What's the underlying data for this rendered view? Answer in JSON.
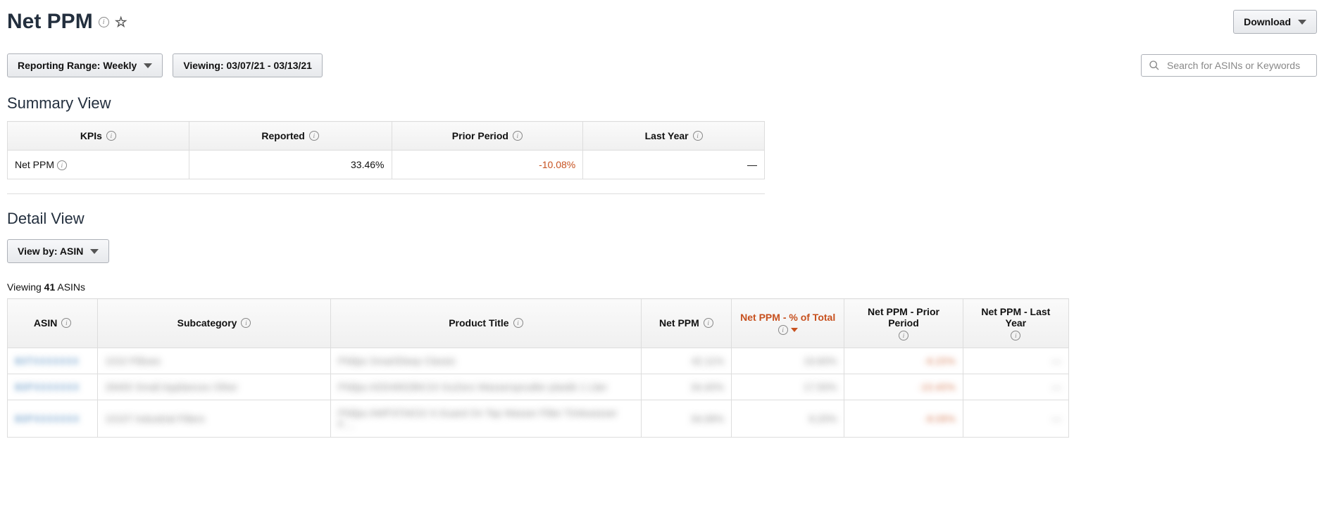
{
  "header": {
    "title": "Net PPM",
    "download_label": "Download"
  },
  "filters": {
    "reporting_range_label": "Reporting Range: Weekly",
    "viewing_label": "Viewing: 03/07/21 - 03/13/21",
    "search_placeholder": "Search for ASINs or Keywords"
  },
  "summary": {
    "section_title": "Summary View",
    "columns": {
      "kpis": "KPIs",
      "reported": "Reported",
      "prior_period": "Prior Period",
      "last_year": "Last Year"
    },
    "row": {
      "label": "Net PPM",
      "reported": "33.46%",
      "prior_period": "-10.08%",
      "last_year": "—"
    }
  },
  "detail": {
    "section_title": "Detail View",
    "view_by_label": "View by: ASIN",
    "viewing_count_prefix": "Viewing ",
    "viewing_count": "41",
    "viewing_count_suffix": " ASINs",
    "columns": {
      "asin": "ASIN",
      "subcategory": "Subcategory",
      "product_title": "Product Title",
      "net_ppm": "Net PPM",
      "pct_of_total": "Net PPM - % of Total",
      "prior_period": "Net PPM - Prior Period",
      "last_year": "Net PPM - Last Year"
    },
    "rows": [
      {
        "asin": "B0TXXXXXXX",
        "subcategory": "1010 Pillows",
        "title": "Philips SmartSleep Classic",
        "net_ppm": "42.11%",
        "pct_of_total": "19.60%",
        "prior_period": "-6.20%",
        "last_year": "—"
      },
      {
        "asin": "B0PXXXXXXX",
        "subcategory": "26400 Small Appliances Other",
        "title": "Philips ADD4902BK/10 GoZero Wassersprudler plastik 1 Liter",
        "net_ppm": "34.40%",
        "pct_of_total": "17.50%",
        "prior_period": "-10.40%",
        "last_year": "—"
      },
      {
        "asin": "B0PXXXXXXX",
        "subcategory": "10107 Industrial Filters",
        "title": "Philips AWP3704/10 X-Guard On Tap Wasser Filter Trinkwasser F…",
        "net_ppm": "34.08%",
        "pct_of_total": "8.20%",
        "prior_period": "-8.08%",
        "last_year": "—"
      }
    ]
  }
}
